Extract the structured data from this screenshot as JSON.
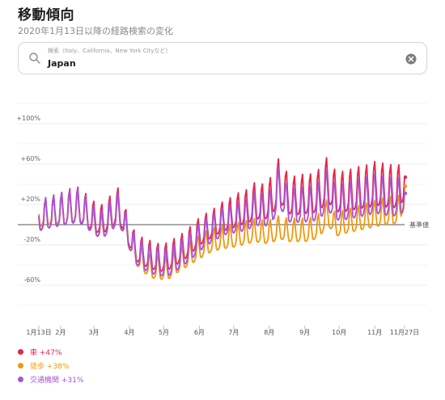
{
  "header": {
    "title": "移動傾向",
    "subtitle": "2020年1月13日以降の経路検索の変化"
  },
  "search": {
    "placeholder": "検索（Italy、California、New York Cityなど）",
    "value": "Japan"
  },
  "colors": {
    "driving": "#e5264d",
    "walking": "#f0980e",
    "transit": "#a953d6",
    "baseline": "#555555",
    "grid": "#eeeeee"
  },
  "chart_data": {
    "type": "line",
    "baseline_label": "基準値",
    "y_ticks": [
      100,
      60,
      20,
      -20,
      -60
    ],
    "y_tick_labels": [
      "+100%",
      "+60%",
      "+20%",
      "-20%",
      "-60%"
    ],
    "ylim": [
      -100,
      130
    ],
    "x_ticks": [
      "1月13日",
      "2月",
      "3月",
      "4月",
      "5月",
      "6月",
      "7月",
      "8月",
      "9月",
      "10月",
      "11月",
      "11月27日"
    ],
    "x_tick_dates": [
      "2020-01-13",
      "2020-02-01",
      "2020-03-01",
      "2020-04-01",
      "2020-05-01",
      "2020-06-01",
      "2020-07-01",
      "2020-08-01",
      "2020-09-01",
      "2020-10-01",
      "2020-11-01",
      "2020-11-27"
    ],
    "series": [
      {
        "name": "車",
        "key": "driving",
        "legend_label": "車 +47%",
        "end_value": 47,
        "weekly_anchors": [
          [
            "2020-01-13",
            5
          ],
          [
            "2020-01-20",
            8
          ],
          [
            "2020-01-27",
            10
          ],
          [
            "2020-02-03",
            12
          ],
          [
            "2020-02-10",
            15
          ],
          [
            "2020-02-17",
            16
          ],
          [
            "2020-02-24",
            10
          ],
          [
            "2020-03-02",
            4
          ],
          [
            "2020-03-09",
            2
          ],
          [
            "2020-03-16",
            10
          ],
          [
            "2020-03-23",
            16
          ],
          [
            "2020-03-30",
            -5
          ],
          [
            "2020-04-06",
            -25
          ],
          [
            "2020-04-13",
            -30
          ],
          [
            "2020-04-20",
            -33
          ],
          [
            "2020-04-27",
            -36
          ],
          [
            "2020-05-04",
            -35
          ],
          [
            "2020-05-11",
            -30
          ],
          [
            "2020-05-18",
            -25
          ],
          [
            "2020-05-25",
            -18
          ],
          [
            "2020-06-01",
            -10
          ],
          [
            "2020-06-08",
            -5
          ],
          [
            "2020-06-15",
            0
          ],
          [
            "2020-06-22",
            5
          ],
          [
            "2020-06-29",
            8
          ],
          [
            "2020-07-06",
            12
          ],
          [
            "2020-07-13",
            14
          ],
          [
            "2020-07-20",
            20
          ],
          [
            "2020-07-27",
            18
          ],
          [
            "2020-08-03",
            24
          ],
          [
            "2020-08-10",
            40
          ],
          [
            "2020-08-17",
            26
          ],
          [
            "2020-08-24",
            24
          ],
          [
            "2020-08-31",
            26
          ],
          [
            "2020-09-07",
            26
          ],
          [
            "2020-09-14",
            30
          ],
          [
            "2020-09-21",
            40
          ],
          [
            "2020-09-28",
            28
          ],
          [
            "2020-10-05",
            28
          ],
          [
            "2020-10-12",
            30
          ],
          [
            "2020-10-19",
            32
          ],
          [
            "2020-10-26",
            33
          ],
          [
            "2020-11-02",
            36
          ],
          [
            "2020-11-09",
            34
          ],
          [
            "2020-11-16",
            33
          ],
          [
            "2020-11-23",
            33
          ],
          [
            "2020-11-27",
            47
          ]
        ]
      },
      {
        "name": "徒歩",
        "key": "walking",
        "legend_label": "徒歩 +38%",
        "end_value": 38,
        "weekly_anchors": [
          [
            "2020-01-13",
            8
          ],
          [
            "2020-01-20",
            10
          ],
          [
            "2020-01-27",
            12
          ],
          [
            "2020-02-03",
            10
          ],
          [
            "2020-02-10",
            13
          ],
          [
            "2020-02-17",
            14
          ],
          [
            "2020-02-24",
            8
          ],
          [
            "2020-03-02",
            -2
          ],
          [
            "2020-03-09",
            -5
          ],
          [
            "2020-03-16",
            5
          ],
          [
            "2020-03-23",
            12
          ],
          [
            "2020-03-30",
            -8
          ],
          [
            "2020-04-06",
            -30
          ],
          [
            "2020-04-13",
            -38
          ],
          [
            "2020-04-20",
            -44
          ],
          [
            "2020-04-27",
            -45
          ],
          [
            "2020-05-04",
            -46
          ],
          [
            "2020-05-11",
            -40
          ],
          [
            "2020-05-18",
            -35
          ],
          [
            "2020-05-25",
            -30
          ],
          [
            "2020-06-01",
            -25
          ],
          [
            "2020-06-08",
            -20
          ],
          [
            "2020-06-15",
            -17
          ],
          [
            "2020-06-22",
            -15
          ],
          [
            "2020-06-29",
            -14
          ],
          [
            "2020-07-06",
            -12
          ],
          [
            "2020-07-13",
            -10
          ],
          [
            "2020-07-20",
            -8
          ],
          [
            "2020-07-27",
            -10
          ],
          [
            "2020-08-03",
            -9
          ],
          [
            "2020-08-10",
            -5
          ],
          [
            "2020-08-17",
            -8
          ],
          [
            "2020-08-24",
            -8
          ],
          [
            "2020-08-31",
            -8
          ],
          [
            "2020-09-07",
            -7
          ],
          [
            "2020-09-14",
            -3
          ],
          [
            "2020-09-21",
            10
          ],
          [
            "2020-09-28",
            -3
          ],
          [
            "2020-10-05",
            0
          ],
          [
            "2020-10-12",
            2
          ],
          [
            "2020-10-19",
            4
          ],
          [
            "2020-10-26",
            6
          ],
          [
            "2020-11-02",
            8
          ],
          [
            "2020-11-09",
            10
          ],
          [
            "2020-11-16",
            11
          ],
          [
            "2020-11-23",
            12
          ],
          [
            "2020-11-27",
            38
          ]
        ]
      },
      {
        "name": "交通機関",
        "key": "transit",
        "legend_label": "交通機関 +31%",
        "end_value": 31,
        "weekly_anchors": [
          [
            "2020-01-13",
            6
          ],
          [
            "2020-01-20",
            8
          ],
          [
            "2020-01-27",
            10
          ],
          [
            "2020-02-03",
            12
          ],
          [
            "2020-02-10",
            14
          ],
          [
            "2020-02-17",
            15
          ],
          [
            "2020-02-24",
            8
          ],
          [
            "2020-03-02",
            0
          ],
          [
            "2020-03-09",
            -3
          ],
          [
            "2020-03-16",
            6
          ],
          [
            "2020-03-23",
            12
          ],
          [
            "2020-03-30",
            -8
          ],
          [
            "2020-04-06",
            -28
          ],
          [
            "2020-04-13",
            -34
          ],
          [
            "2020-04-20",
            -38
          ],
          [
            "2020-04-27",
            -40
          ],
          [
            "2020-05-04",
            -41
          ],
          [
            "2020-05-11",
            -36
          ],
          [
            "2020-05-18",
            -30
          ],
          [
            "2020-05-25",
            -24
          ],
          [
            "2020-06-01",
            -16
          ],
          [
            "2020-06-08",
            -10
          ],
          [
            "2020-06-15",
            -5
          ],
          [
            "2020-06-22",
            0
          ],
          [
            "2020-06-29",
            2
          ],
          [
            "2020-07-06",
            4
          ],
          [
            "2020-07-13",
            6
          ],
          [
            "2020-07-20",
            12
          ],
          [
            "2020-07-27",
            10
          ],
          [
            "2020-08-03",
            14
          ],
          [
            "2020-08-10",
            34
          ],
          [
            "2020-08-17",
            16
          ],
          [
            "2020-08-24",
            15
          ],
          [
            "2020-08-31",
            16
          ],
          [
            "2020-09-07",
            16
          ],
          [
            "2020-09-14",
            20
          ],
          [
            "2020-09-21",
            30
          ],
          [
            "2020-09-28",
            18
          ],
          [
            "2020-10-05",
            18
          ],
          [
            "2020-10-12",
            20
          ],
          [
            "2020-10-19",
            22
          ],
          [
            "2020-10-26",
            24
          ],
          [
            "2020-11-02",
            26
          ],
          [
            "2020-11-09",
            24
          ],
          [
            "2020-11-16",
            23
          ],
          [
            "2020-11-23",
            23
          ],
          [
            "2020-11-27",
            31
          ]
        ]
      }
    ]
  }
}
